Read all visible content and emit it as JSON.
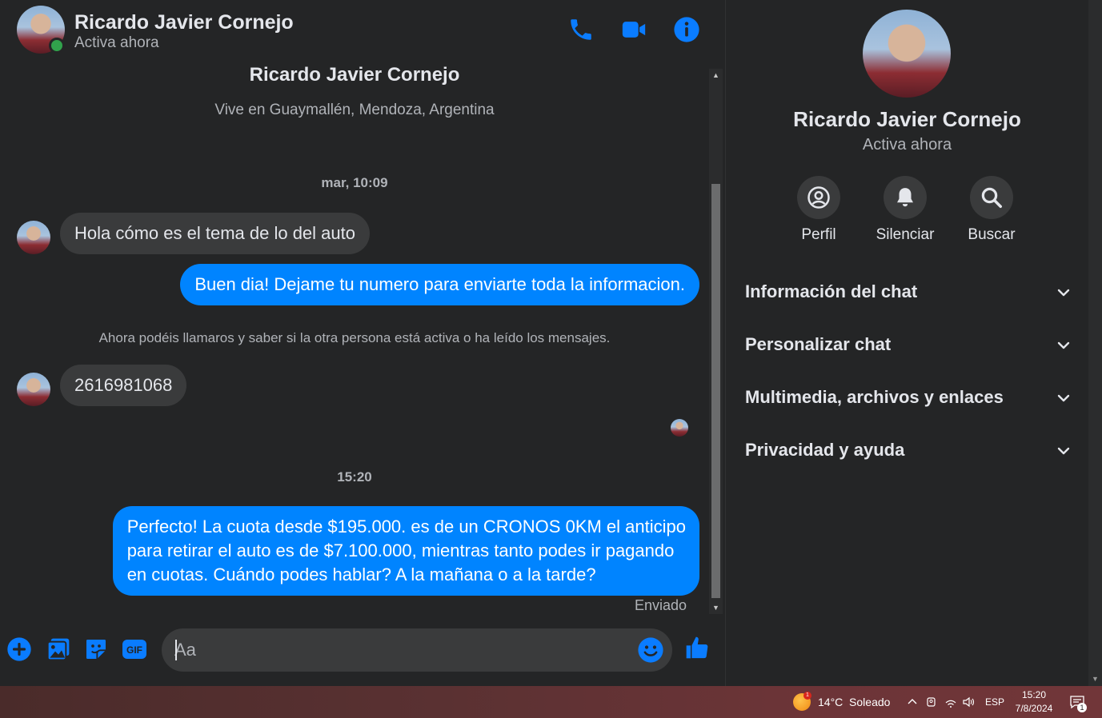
{
  "contact": {
    "name": "Ricardo Javier Cornejo",
    "status": "Activa ahora",
    "location": "Vive en Guaymallén, Mendoza, Argentina"
  },
  "colors": {
    "accent": "#0084ff",
    "background": "#242526",
    "bubble_in": "#3a3b3c",
    "online": "#31a24c"
  },
  "header_icons": [
    "phone-icon",
    "video-call-icon",
    "info-icon"
  ],
  "conversation": {
    "time_1": "mar, 10:09",
    "msg_in_1": "Hola cómo es el tema de lo del auto",
    "msg_out_1": "Buen dia! Dejame tu numero para enviarte toda la informacion.",
    "notice": "Ahora podéis llamaros y saber si la otra persona está activa o ha leído los mensajes.",
    "msg_in_2": "2616981068",
    "time_2": "15:20",
    "msg_out_2_lines": [
      "Perfecto! La cuota desde $195.000. es de un CRONOS 0KM el anticipo",
      "para retirar el auto es de $7.100.000, mientras tanto podes ir pagando",
      "en cuotas. Cuándo podes hablar? A la mañana o a la tarde?"
    ],
    "sent_status": "Enviado"
  },
  "composer": {
    "placeholder": "Aa",
    "icons": [
      "plus-icon",
      "photo-icon",
      "sticker-icon",
      "gif-icon",
      "emoji-icon",
      "like-icon"
    ],
    "gif_label": "GIF"
  },
  "info_panel": {
    "actions": [
      {
        "label": "Perfil",
        "icon": "profile-icon"
      },
      {
        "label": "Silenciar",
        "icon": "bell-icon"
      },
      {
        "label": "Buscar",
        "icon": "search-icon"
      }
    ],
    "sections": [
      "Información del chat",
      "Personalizar chat",
      "Multimedia, archivos y enlaces",
      "Privacidad y ayuda"
    ]
  },
  "taskbar": {
    "weather": "14°C  Soleado",
    "weather_badge": "1",
    "language": "ESP",
    "time": "15:20",
    "date": "7/8/2024",
    "notification_count": "1"
  }
}
